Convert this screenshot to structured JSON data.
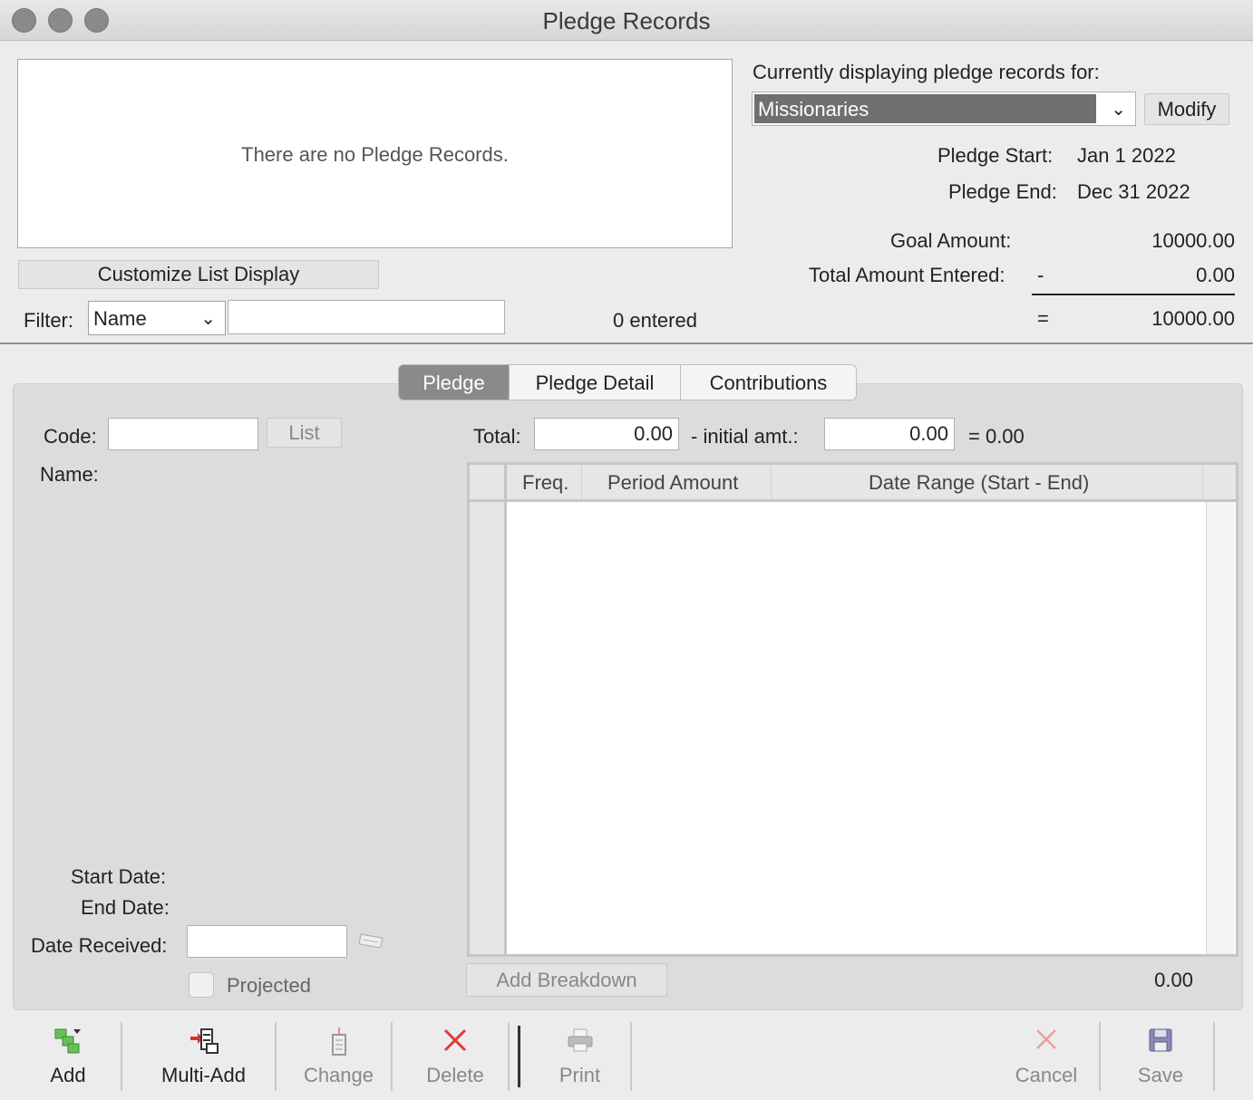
{
  "window": {
    "title": "Pledge Records"
  },
  "list": {
    "empty_message": "There are no Pledge Records.",
    "customize_label": "Customize List Display"
  },
  "filter": {
    "label": "Filter:",
    "field_value": "Name",
    "text_value": "",
    "count_text": "0 entered"
  },
  "header": {
    "displaying_label": "Currently displaying pledge records for:",
    "category": "Missionaries",
    "modify_label": "Modify",
    "pledge_start_label": "Pledge Start:",
    "pledge_start": "Jan 1 2022",
    "pledge_end_label": "Pledge End:",
    "pledge_end": "Dec 31 2022",
    "goal_label": "Goal Amount:",
    "goal_value": "10000.00",
    "total_entered_label": "Total Amount Entered:",
    "minus_sign": "-",
    "total_entered_value": "0.00",
    "equals_sign": "=",
    "remaining_value": "10000.00"
  },
  "tabs": [
    {
      "label": "Pledge",
      "active": true
    },
    {
      "label": "Pledge Detail",
      "active": false
    },
    {
      "label": "Contributions",
      "active": false
    }
  ],
  "form": {
    "code_label": "Code:",
    "code_value": "",
    "list_button": "List",
    "name_label": "Name:",
    "start_date_label": "Start Date:",
    "end_date_label": "End Date:",
    "date_received_label": "Date Received:",
    "date_received_value": "",
    "projected_label": "Projected",
    "total_label": "Total:",
    "total_value": "0.00",
    "initial_label": "- initial amt.:",
    "initial_value": "0.00",
    "result_text": "= 0.00"
  },
  "grid": {
    "columns": [
      "Freq.",
      "Period Amount",
      "Date Range (Start - End)"
    ],
    "add_breakdown": "Add Breakdown",
    "footer_total": "0.00"
  },
  "toolbar": {
    "add": "Add",
    "multi_add": "Multi-Add",
    "change": "Change",
    "delete": "Delete",
    "print": "Print",
    "cancel": "Cancel",
    "save": "Save"
  },
  "colors": {
    "tab_active": "#8a8a8a",
    "delete_red": "#e03a3a",
    "add_green": "#4caf50",
    "save_blue": "#4a4a8a"
  }
}
